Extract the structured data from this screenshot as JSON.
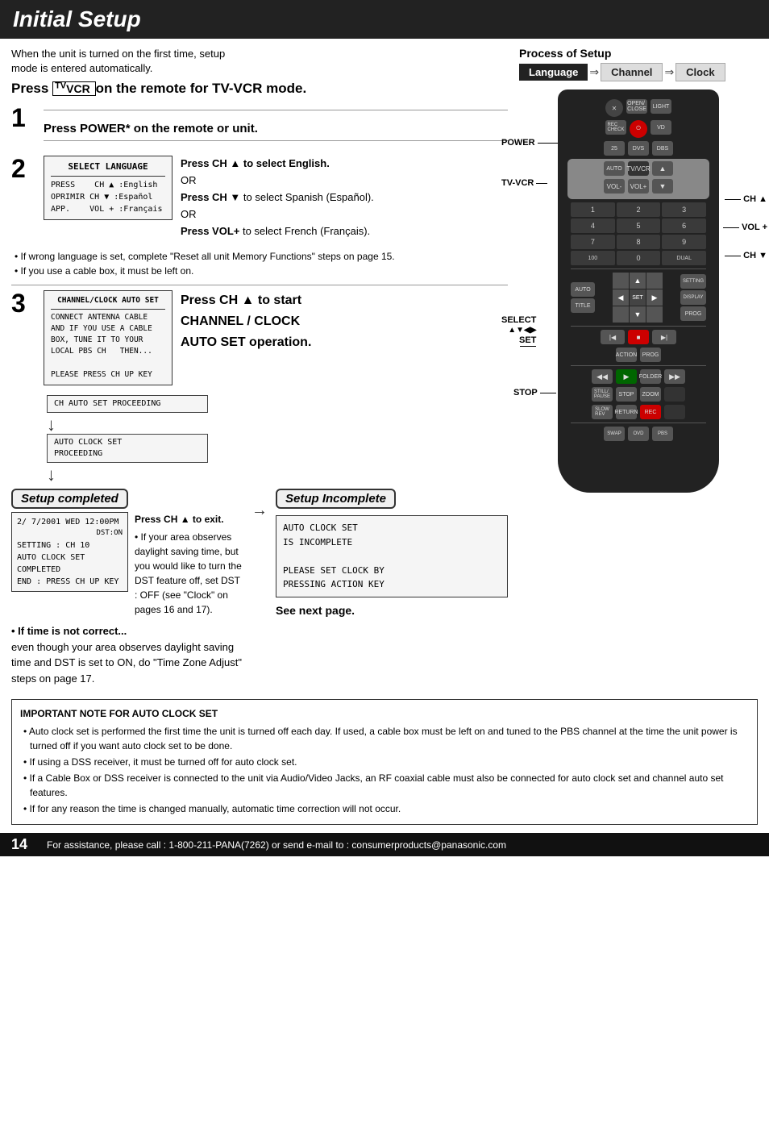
{
  "header": {
    "title": "Initial Setup"
  },
  "intro": {
    "line1": "When the unit is turned on the first time, setup",
    "line2": "mode is entered automatically.",
    "press_tv_vcr": "Press",
    "tv_vcr_label": "TV",
    "tv_vcr_sub": "VCR",
    "on_remote": "on the remote for TV-VCR mode."
  },
  "process_setup": {
    "title": "Process of Setup",
    "steps": [
      {
        "label": "Language",
        "state": "active"
      },
      {
        "arrow": "⇒"
      },
      {
        "label": "Channel",
        "state": "inactive"
      },
      {
        "arrow": "⇒"
      },
      {
        "label": "Clock",
        "state": "inactive"
      }
    ]
  },
  "step1": {
    "number": "1",
    "instruction": "Press POWER* on the remote or unit."
  },
  "step2": {
    "number": "2",
    "screen_title": "SELECT LANGUAGE",
    "screen_lines": [
      "PRESS   CH ▲ :English",
      "OPRIMIR CH ▼ :Español",
      "APP.    VOL + :Français"
    ],
    "instructions": [
      {
        "text": "Press CH ▲ to select English.",
        "bold": true
      },
      {
        "text": "OR",
        "bold": false
      },
      {
        "text": "Press CH ▼ to select Spanish (Español).",
        "bold_part": "Press CH ▼"
      },
      {
        "text": "OR",
        "bold": false
      },
      {
        "text": "Press VOL+ to select French (Français).",
        "bold_part": "Press VOL+"
      }
    ]
  },
  "bullet_notes": [
    "If wrong language is set, complete \"Reset all unit Memory Functions\" steps on page 15.",
    "If you use a cable box, it must be left on."
  ],
  "step3": {
    "number": "3",
    "screen_title": "CHANNEL/CLOCK AUTO SET",
    "screen_lines": [
      "CONNECT ANTENNA CABLE",
      "AND IF YOU USE A CABLE",
      "BOX, TUNE IT TO YOUR",
      "LOCAL PBS CH   THEN...",
      "",
      "PLEASE PRESS CH UP KEY"
    ],
    "instruction_bold": "Press CH ▲ to start",
    "instruction_rest": "CHANNEL / CLOCK AUTO SET operation."
  },
  "flow": {
    "box1": "CH AUTO SET PROCEEDING",
    "arrow1": "↓",
    "box2_line1": "AUTO CLOCK SET",
    "box2_line2": "PROCEEDING",
    "arrow2": "↓"
  },
  "setup_completed": {
    "label": "Setup completed",
    "screen_lines": [
      "2/ 7/2001 WED 12:00PM",
      "          DST:ON",
      "SETTING : CH 10",
      "AUTO CLOCK SET",
      "COMPLETED",
      "END : PRESS CH UP KEY"
    ],
    "notes": [
      "Press CH ▲ to exit.",
      "• If your area observes daylight saving time, but you would like to turn the DST feature off, set DST : OFF (see \"Clock\" on pages 16 and 17)."
    ]
  },
  "setup_incomplete": {
    "label": "Setup Incomplete",
    "screen_lines": [
      "AUTO CLOCK SET",
      "IS INCOMPLETE",
      "",
      "PLEASE SET CLOCK BY",
      "PRESSING ACTION KEY"
    ],
    "see_next": "See next page."
  },
  "if_time_not_correct": {
    "heading": "• If time is not correct...",
    "body": "even though your area observes daylight saving time and DST is set to ON, do \"Time Zone Adjust\" steps on page 17."
  },
  "important_note": {
    "title": "IMPORTANT NOTE FOR AUTO CLOCK SET",
    "bullets": [
      "Auto clock set is performed the first time the unit is turned off each day. If used, a cable box must be left on and tuned to the PBS channel at the time the unit power is turned off if you want auto clock set to be done.",
      "If using a DSS receiver, it must be turned off for auto clock set.",
      "If a Cable Box or DSS receiver is connected to the unit via Audio/Video Jacks, an RF coaxial cable must also be connected for auto clock set and channel auto set features.",
      "If for any reason the time is changed manually, automatic time correction will not occur."
    ]
  },
  "footer": {
    "page_number": "14",
    "support_text": "For assistance, please call : 1-800-211-PANA(7262) or send e-mail to : consumerproducts@panasonic.com"
  },
  "remote": {
    "labels": {
      "power": "POWER",
      "tv_vcr": "TV-VCR",
      "ch_up": "CH ▲",
      "vol_plus": "VOL +",
      "ch_down": "CH ▼",
      "select": "SELECT",
      "select_arrows": "▲▼◀▶",
      "set": "SET",
      "stop": "STOP"
    }
  }
}
